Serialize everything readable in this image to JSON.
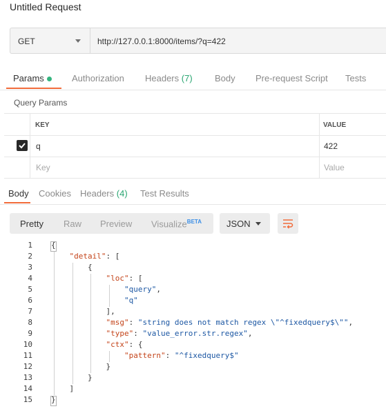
{
  "title": "Untitled Request",
  "request": {
    "method": "GET",
    "url": "http://127.0.0.1:8000/items/?q=422"
  },
  "request_tabs": [
    {
      "label": "Params",
      "count": "",
      "active": true
    },
    {
      "label": "Authorization",
      "count": "",
      "active": false
    },
    {
      "label": "Headers",
      "count": "(7)",
      "active": false
    },
    {
      "label": "Body",
      "count": "",
      "active": false
    },
    {
      "label": "Pre-request Script",
      "count": "",
      "active": false
    },
    {
      "label": "Tests",
      "count": "",
      "active": false
    }
  ],
  "query_params": {
    "title": "Query Params",
    "columns": {
      "key": "KEY",
      "value": "VALUE"
    },
    "rows": [
      {
        "checked": true,
        "key": "q",
        "value": "422"
      }
    ],
    "placeholder": {
      "key": "Key",
      "value": "Value"
    }
  },
  "response_tabs": [
    {
      "label": "Body",
      "count": "",
      "active": true
    },
    {
      "label": "Cookies",
      "count": "",
      "active": false
    },
    {
      "label": "Headers",
      "count": "(4)",
      "active": false
    },
    {
      "label": "Test Results",
      "count": "",
      "active": false
    }
  ],
  "format_toolbar": {
    "modes": [
      "Pretty",
      "Raw",
      "Preview",
      "Visualize"
    ],
    "active_mode": "Pretty",
    "beta_badge": "BETA",
    "language": "JSON"
  },
  "response_body": {
    "lines": [
      {
        "n": "1",
        "indent": 0,
        "parts": [
          [
            "p",
            "{"
          ]
        ]
      },
      {
        "n": "2",
        "indent": 1,
        "parts": [
          [
            "k",
            "\"detail\""
          ],
          [
            "p",
            ": ["
          ]
        ]
      },
      {
        "n": "3",
        "indent": 2,
        "parts": [
          [
            "p",
            "{"
          ]
        ]
      },
      {
        "n": "4",
        "indent": 3,
        "parts": [
          [
            "k",
            "\"loc\""
          ],
          [
            "p",
            ": ["
          ]
        ]
      },
      {
        "n": "5",
        "indent": 4,
        "parts": [
          [
            "s",
            "\"query\""
          ],
          [
            "p",
            ","
          ]
        ]
      },
      {
        "n": "6",
        "indent": 4,
        "parts": [
          [
            "s",
            "\"q\""
          ]
        ]
      },
      {
        "n": "7",
        "indent": 3,
        "parts": [
          [
            "p",
            "],"
          ]
        ]
      },
      {
        "n": "8",
        "indent": 3,
        "parts": [
          [
            "k",
            "\"msg\""
          ],
          [
            "p",
            ": "
          ],
          [
            "s",
            "\"string does not match regex \\\"^fixedquery$\\\"\""
          ],
          [
            "p",
            ","
          ]
        ]
      },
      {
        "n": "9",
        "indent": 3,
        "parts": [
          [
            "k",
            "\"type\""
          ],
          [
            "p",
            ": "
          ],
          [
            "s",
            "\"value_error.str.regex\""
          ],
          [
            "p",
            ","
          ]
        ]
      },
      {
        "n": "10",
        "indent": 3,
        "parts": [
          [
            "k",
            "\"ctx\""
          ],
          [
            "p",
            ": {"
          ]
        ]
      },
      {
        "n": "11",
        "indent": 4,
        "parts": [
          [
            "k",
            "\"pattern\""
          ],
          [
            "p",
            ": "
          ],
          [
            "s",
            "\"^fixedquery$\""
          ]
        ]
      },
      {
        "n": "12",
        "indent": 3,
        "parts": [
          [
            "p",
            "}"
          ]
        ]
      },
      {
        "n": "13",
        "indent": 2,
        "parts": [
          [
            "p",
            "}"
          ]
        ]
      },
      {
        "n": "14",
        "indent": 1,
        "parts": [
          [
            "p",
            "]"
          ]
        ]
      },
      {
        "n": "15",
        "indent": 0,
        "parts": [
          [
            "p",
            "}"
          ]
        ]
      }
    ]
  },
  "colors": {
    "accent": "#f26b3a",
    "count_green": "#2aa672",
    "json_key": "#c4441a",
    "json_string": "#1c57a3",
    "beta": "#3a8ee6"
  }
}
